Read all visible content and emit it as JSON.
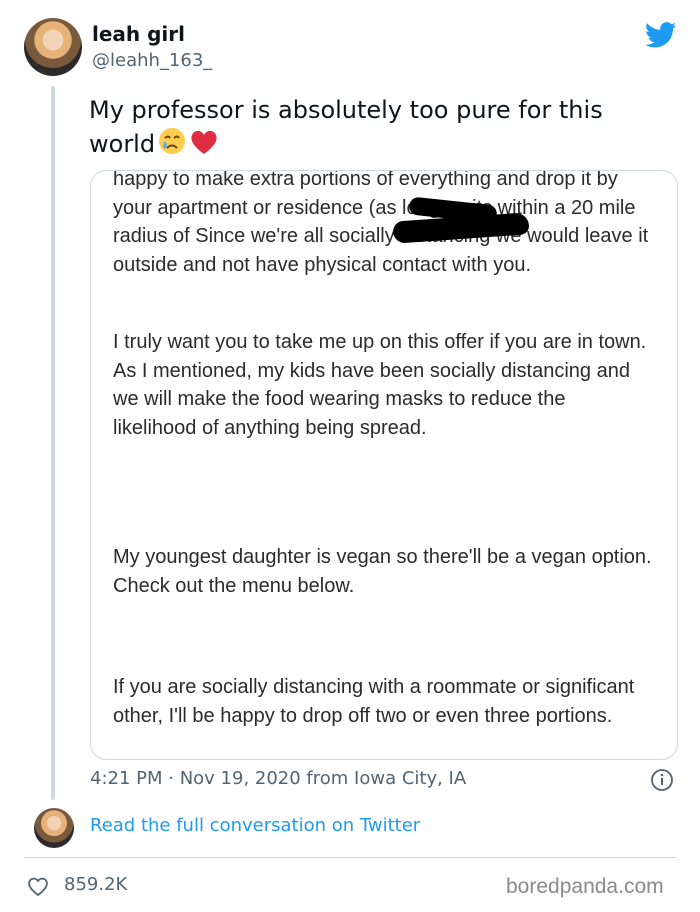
{
  "tweet": {
    "display_name": "leah girl",
    "handle": "@leahh_163_",
    "text": "My professor is absolutely too pure for this world",
    "timestamp": "4:21 PM · Nov 19, 2020 from Iowa City, IA",
    "read_link": "Read the full conversation on Twitter",
    "likes": "859.2K"
  },
  "media": {
    "paragraphs": [
      "happy to make extra portions of everything and drop it by your apartment or residence (as long as its within a 20 mile radius of                  Since we're all socially distancing we would leave it outside and not have physical contact with you.",
      "I truly want you to take me up on this offer if you are in town.  As I mentioned, my kids have been socially distancing and we will make the food wearing masks to reduce the likelihood of anything being spread.",
      "My youngest daughter is vegan so there'll be a vegan option.  Check out the menu below.",
      "If you are socially distancing with a roommate or significant other, I'll be happy to drop off two or even three portions."
    ]
  },
  "watermark": "boredpanda.com",
  "colors": {
    "twitter_blue": "#1d9bf0",
    "secondary_text": "#536471",
    "border": "#cfd9de"
  },
  "icons": [
    "twitter-bird-icon",
    "info-icon",
    "heart-icon",
    "crying-face-emoji",
    "red-heart-emoji"
  ]
}
